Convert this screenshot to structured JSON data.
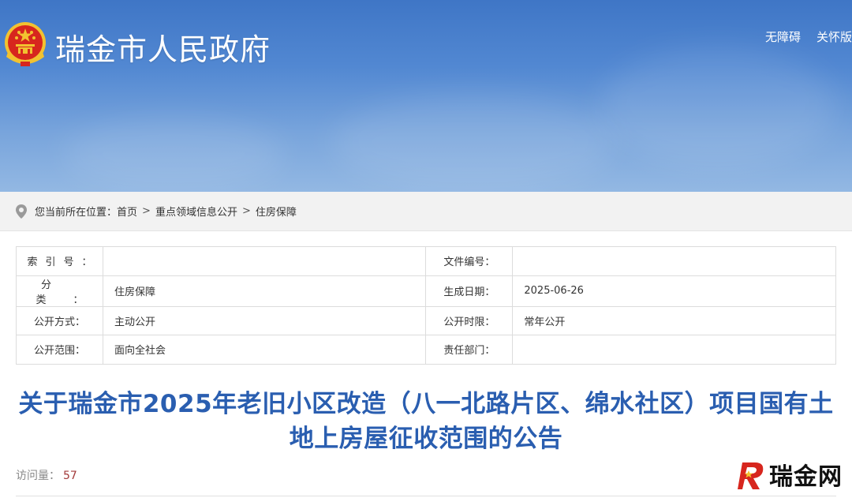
{
  "header": {
    "site_title": "瑞金市人民政府",
    "links": [
      "无障碍",
      "关怀版"
    ]
  },
  "breadcrumb": {
    "prefix": "您当前所在位置：",
    "items": [
      "首页",
      "重点领域信息公开",
      "住房保障"
    ],
    "separator": ">"
  },
  "info_table": {
    "rows": [
      {
        "label1": "索引号：",
        "value1": "",
        "label2": "文件编号：",
        "value2": ""
      },
      {
        "label1": "分类：",
        "value1": "住房保障",
        "label2": "生成日期：",
        "value2": "2025-06-26"
      },
      {
        "label1": "公开方式：",
        "value1": "主动公开",
        "label2": "公开时限：",
        "value2": "常年公开"
      },
      {
        "label1": "公开范围：",
        "value1": "面向全社会",
        "label2": "责任部门：",
        "value2": ""
      }
    ]
  },
  "article": {
    "title": "关于瑞金市2025年老旧小区改造（八一北路片区、绵水社区）项目国有土地上房屋征收范围的公告",
    "visits_label": "访问量：",
    "visits_count": "57"
  },
  "watermark": {
    "text": "瑞金网"
  },
  "colors": {
    "banner_top": "#3f76c6",
    "banner_bottom": "#93b8e3",
    "title_blue": "#2a5eb0",
    "visits_red": "#a33a3a",
    "emblem_red": "#d7261e",
    "emblem_gold": "#f2c230"
  },
  "icons": {
    "emblem": "national-emblem-icon",
    "breadcrumb": "location-pin-icon",
    "watermark": "ruijin-r-logo-icon"
  }
}
